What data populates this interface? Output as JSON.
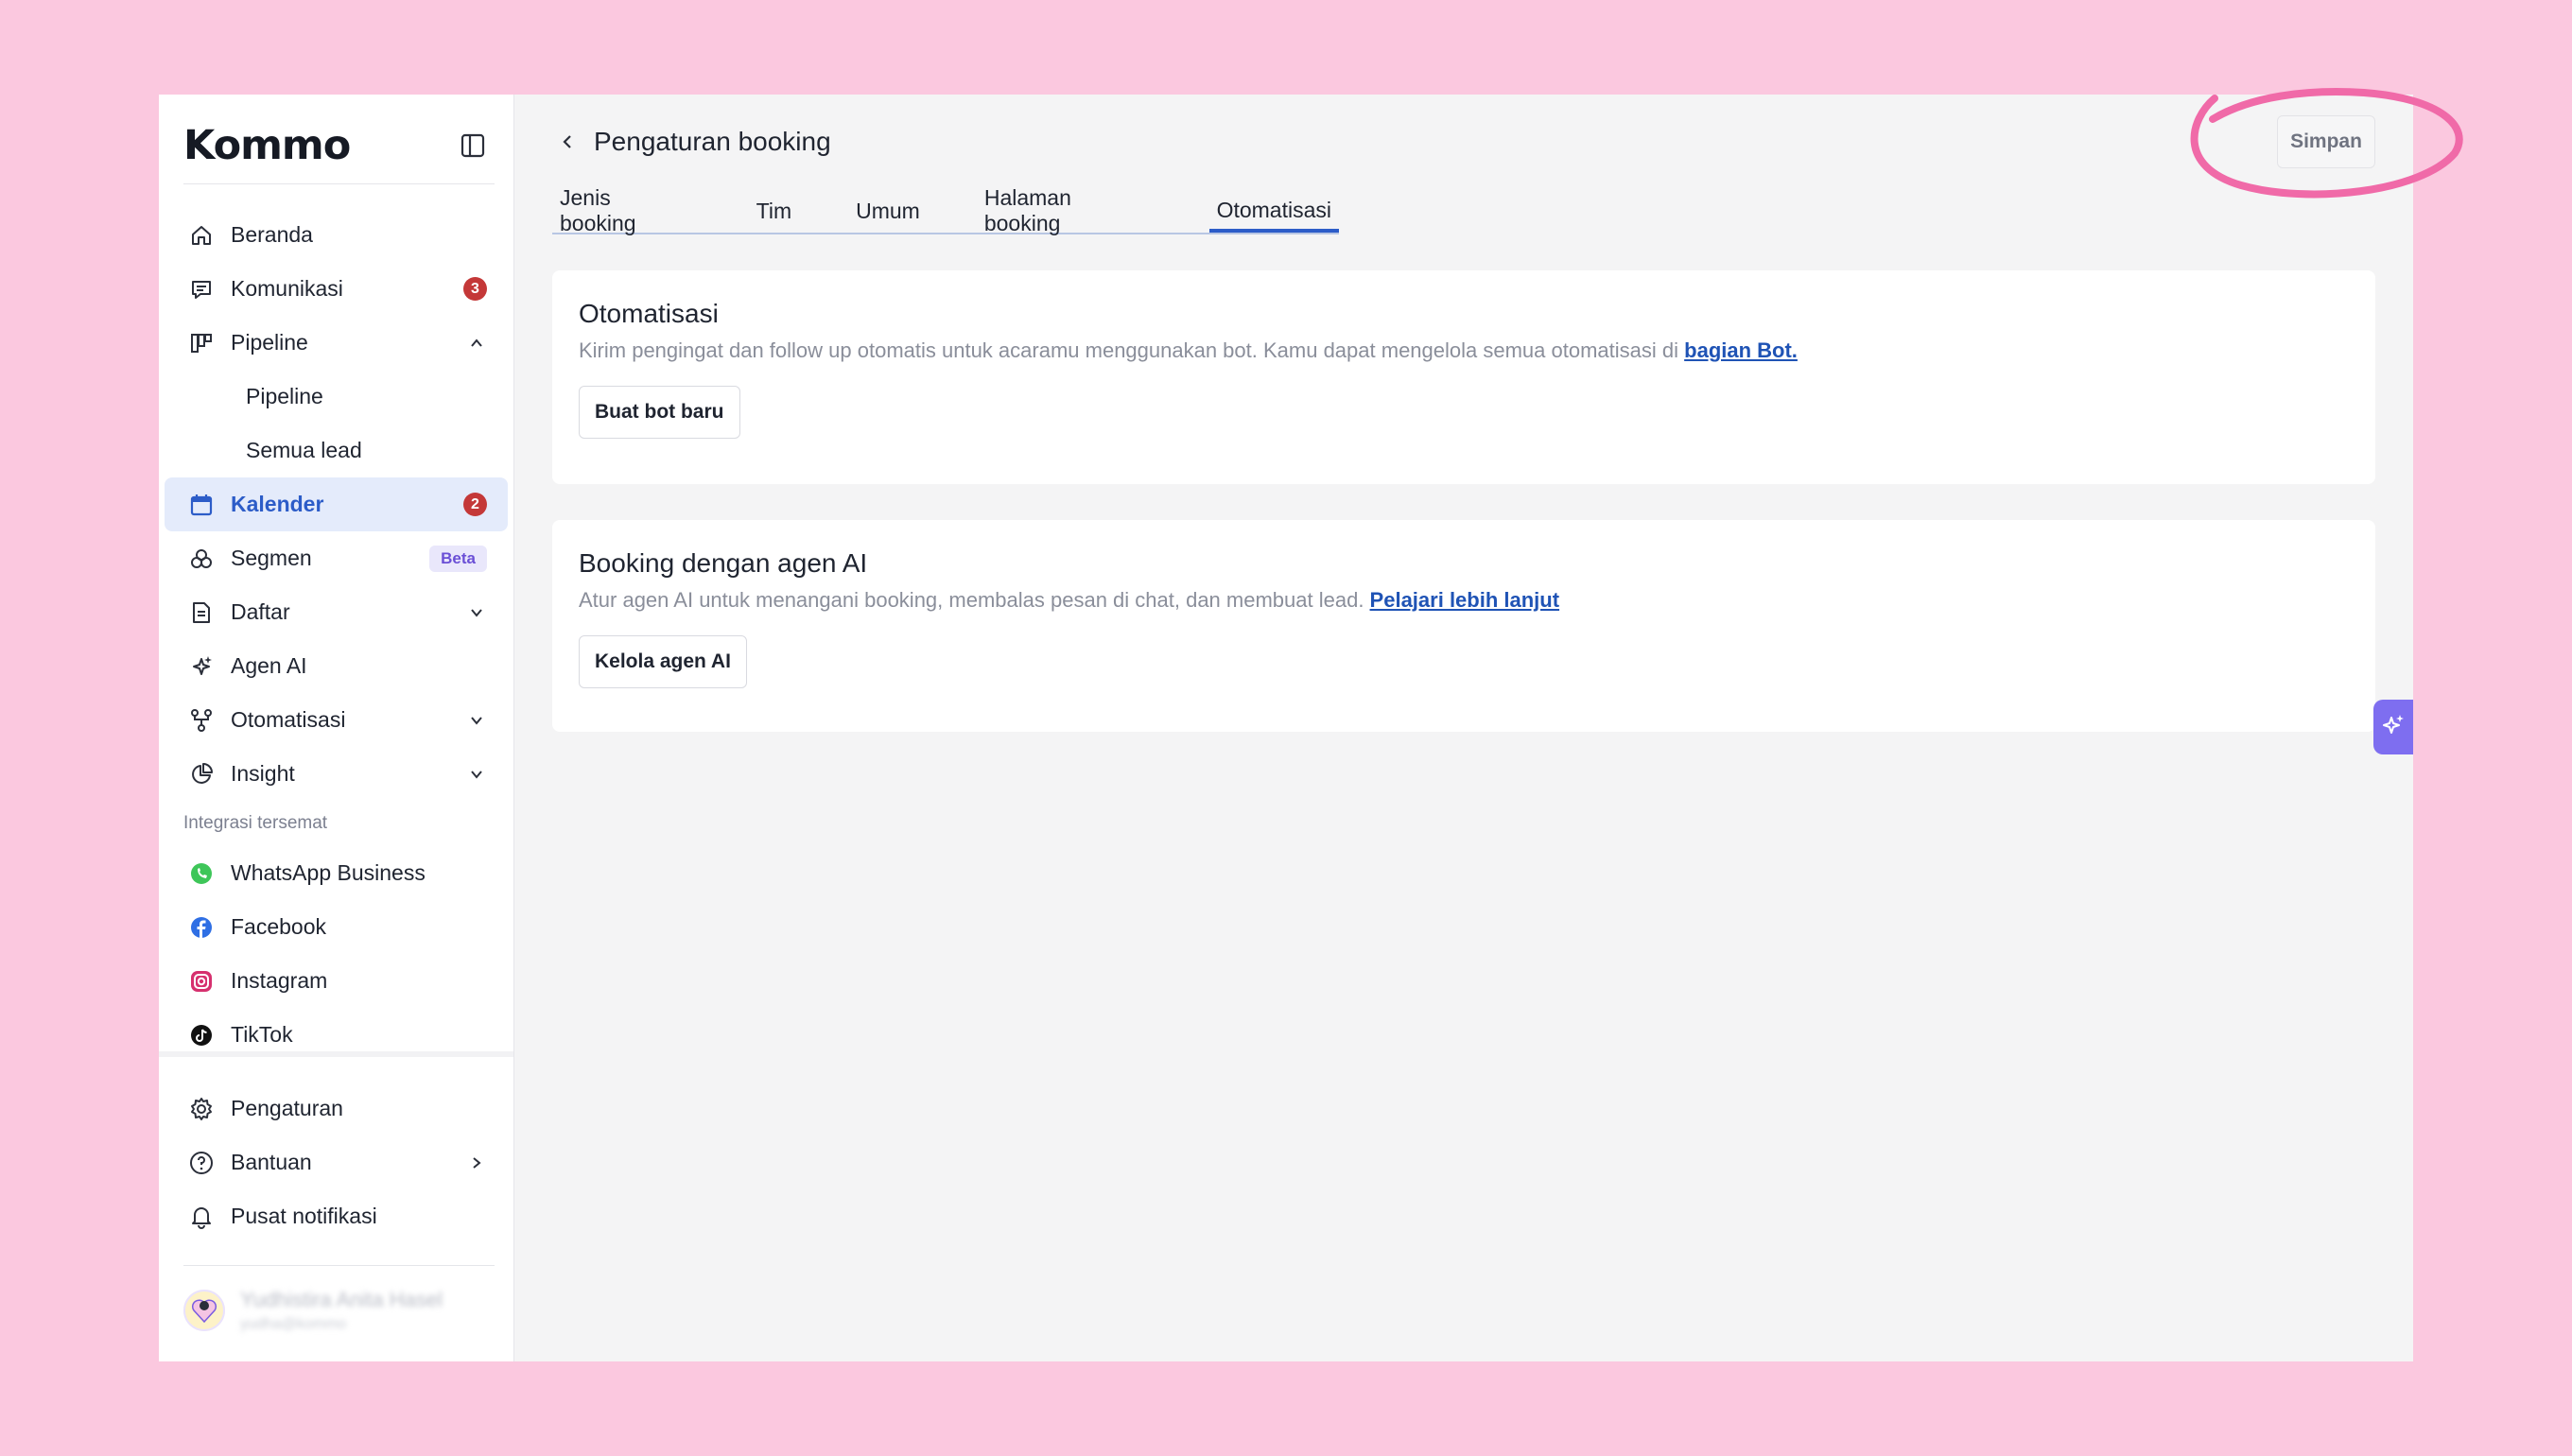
{
  "brand": {
    "logo_text": "Kommo"
  },
  "sidebar": {
    "items": [
      {
        "label": "Beranda",
        "icon": "home-icon"
      },
      {
        "label": "Komunikasi",
        "icon": "chat-icon",
        "badge": "3"
      },
      {
        "label": "Pipeline",
        "icon": "pipeline-icon",
        "expanded": true
      },
      {
        "label": "Pipeline",
        "sub": true
      },
      {
        "label": "Semua lead",
        "sub": true
      },
      {
        "label": "Kalender",
        "icon": "calendar-icon",
        "badge": "2",
        "active": true
      },
      {
        "label": "Segmen",
        "icon": "segment-icon",
        "tag": "Beta"
      },
      {
        "label": "Daftar",
        "icon": "list-icon"
      },
      {
        "label": "Agen AI",
        "icon": "sparkle-icon"
      },
      {
        "label": "Otomatisasi",
        "icon": "automation-icon"
      },
      {
        "label": "Insight",
        "icon": "pie-icon"
      }
    ],
    "pinned_label": "Integrasi tersemat",
    "integrations": [
      {
        "label": "WhatsApp Business",
        "icon": "whatsapp-icon",
        "color": "#3ec659"
      },
      {
        "label": "Facebook",
        "icon": "facebook-icon",
        "color": "#2f6fe4"
      },
      {
        "label": "Instagram",
        "icon": "instagram-icon",
        "color": "#d6306e"
      },
      {
        "label": "TikTok",
        "icon": "tiktok-icon",
        "color": "#111111"
      }
    ],
    "bottom": [
      {
        "label": "Pengaturan",
        "icon": "gear-icon"
      },
      {
        "label": "Bantuan",
        "icon": "help-icon"
      },
      {
        "label": "Pusat notifikasi",
        "icon": "bell-icon"
      }
    ],
    "user": {
      "name": "Yudhistira Anita Hasel",
      "sub": "yudha@kommo"
    }
  },
  "header": {
    "title": "Pengaturan booking",
    "save_label": "Simpan"
  },
  "tabs": [
    "Jenis booking",
    "Tim",
    "Umum",
    "Halaman booking",
    "Otomatisasi"
  ],
  "active_tab": "Otomatisasi",
  "cards": {
    "automation": {
      "title": "Otomatisasi",
      "desc": "Kirim pengingat dan follow up otomatis untuk acaramu menggunakan bot. Kamu dapat mengelola semua otomatisasi di ",
      "link": "bagian Bot.",
      "button": "Buat bot baru"
    },
    "ai_booking": {
      "title": "Booking dengan agen AI",
      "desc": "Atur agen AI untuk menangani booking, membalas pesan di chat, dan membuat lead. ",
      "link": "Pelajari lebih lanjut",
      "button": "Kelola agen AI"
    }
  },
  "colors": {
    "accent": "#2c5cc8",
    "background": "#fbc8df",
    "annotation": "#f06aa8"
  }
}
